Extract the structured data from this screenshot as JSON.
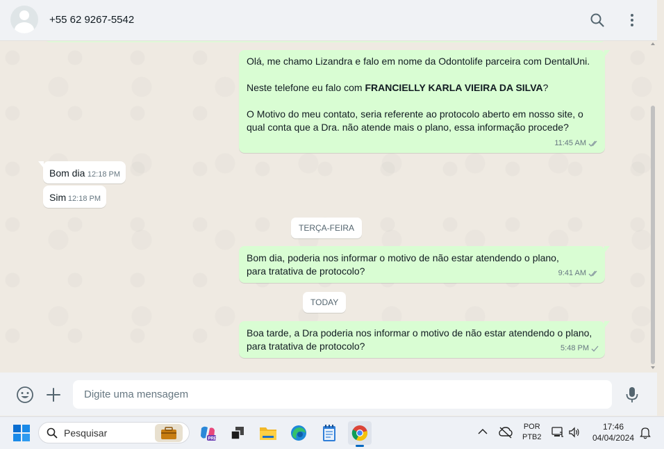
{
  "header": {
    "contact": "+55 62 9267-5542"
  },
  "messages": [
    {
      "dir": "out",
      "p1": "Olá, me chamo Lizandra e falo em nome da Odontolife parceira com DentalUni.",
      "p2_prefix": "Neste telefone eu falo com ",
      "p2_bold": "FRANCIELLY KARLA VIEIRA DA SILVA",
      "p2_suffix": "?",
      "p3": "O Motivo do meu contato, seria referente ao protocolo aberto em nosso site, o qual conta que a Dra. não atende mais o plano, essa informação procede?",
      "time": "11:45 AM"
    },
    {
      "dir": "in",
      "text": "Bom dia",
      "time": "12:18 PM"
    },
    {
      "dir": "in",
      "text": "Sim",
      "time": "12:18 PM"
    },
    {
      "dir": "out",
      "text": "Bom dia, poderia nos informar o motivo de não estar atendendo o plano, para tratativa de protocolo?",
      "time": "9:41 AM"
    },
    {
      "dir": "out",
      "text": "Boa tarde, a Dra poderia nos informar o motivo de não estar atendendo o plano, para tratativa de protocolo?",
      "time": "5:48 PM"
    }
  ],
  "day_labels": {
    "tuesday": "TERÇA-FEIRA",
    "today": "TODAY"
  },
  "composer": {
    "placeholder": "Digite uma mensagem"
  },
  "taskbar": {
    "search_placeholder": "Pesquisar",
    "lang_top": "POR",
    "lang_bottom": "PTB2",
    "time": "17:46",
    "date": "04/04/2024"
  },
  "colors": {
    "outgoing_bubble": "#d9fdd3",
    "incoming_bubble": "#ffffff",
    "read_tick": "#53bdeb",
    "chat_bg": "#efeae2"
  },
  "icons": [
    "default-avatar-icon",
    "search-icon",
    "menu-dots-icon",
    "emoji-icon",
    "plus-icon",
    "microphone-icon",
    "read-receipt-icon",
    "sent-tick-icon",
    "windows-start-icon",
    "briefcase-icon",
    "copilot-icon",
    "task-view-icon",
    "file-explorer-icon",
    "edge-icon",
    "notepad-icon",
    "chrome-icon",
    "chevron-up-icon",
    "cloud-offline-icon",
    "battery-icon",
    "speaker-icon",
    "bell-icon"
  ]
}
